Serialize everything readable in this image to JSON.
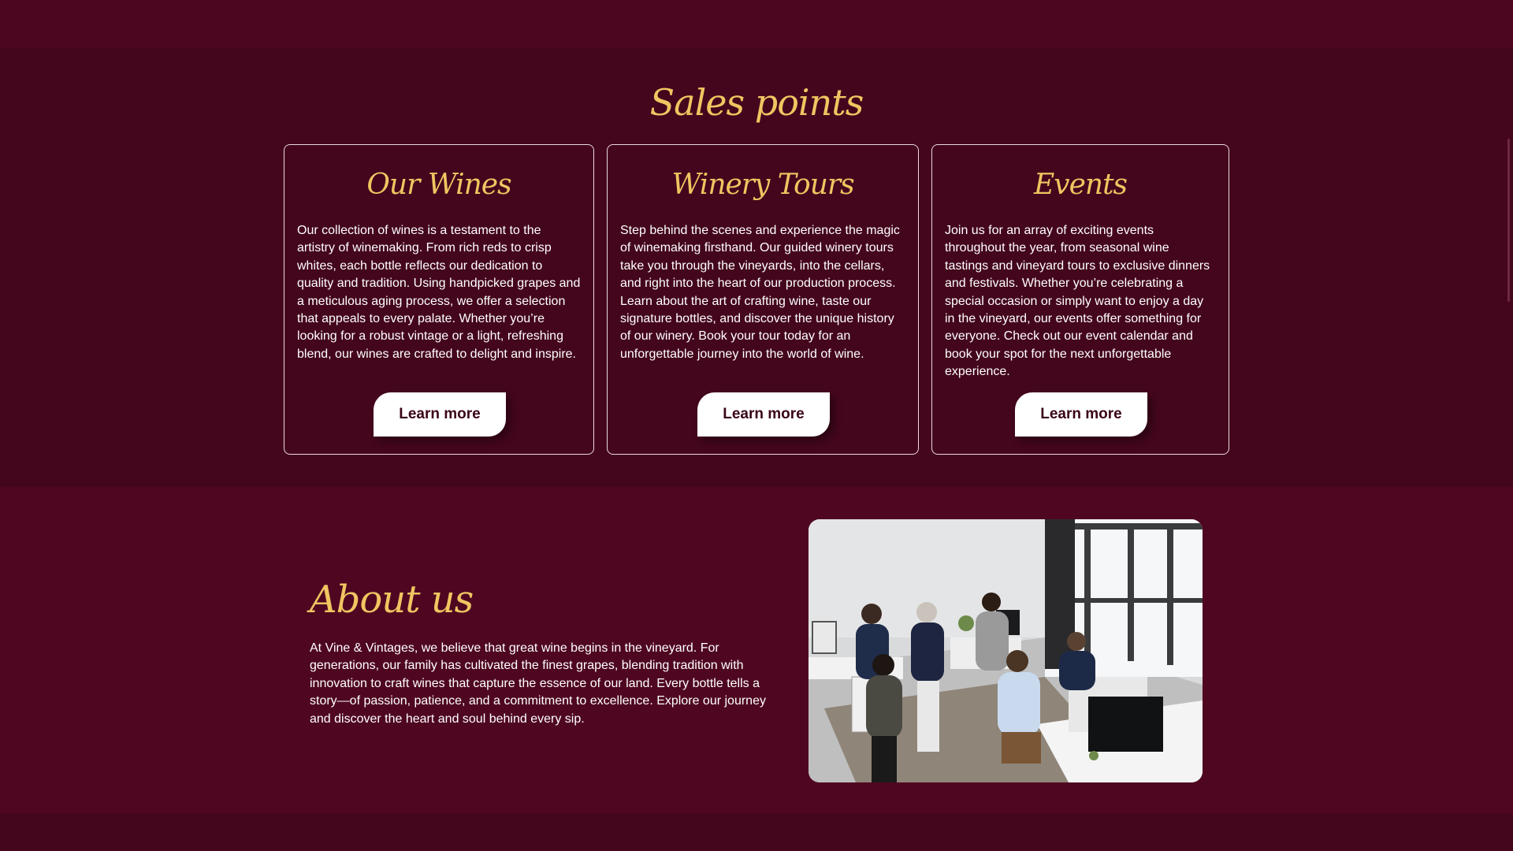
{
  "sales": {
    "title": "Sales points",
    "cards": [
      {
        "title": "Our Wines",
        "text": "Our collection of wines is a testament to the artistry of winemaking. From rich reds to crisp whites, each bottle reflects our dedication to quality and tradition. Using handpicked grapes and a meticulous aging process, we offer a selection that appeals to every palate. Whether you’re looking for a robust vintage or a light, refreshing blend, our wines are crafted to delight and inspire.",
        "button": "Learn more"
      },
      {
        "title": "Winery Tours",
        "text": "Step behind the scenes and experience the magic of winemaking firsthand. Our guided winery tours take you through the vineyards, into the cellars, and right into the heart of our production process. Learn about the art of crafting wine, taste our signature bottles, and discover the unique history of our winery. Book your tour today for an unforgettable journey into the world of wine.",
        "button": "Learn more"
      },
      {
        "title": "Events",
        "text": "Join us for an array of exciting events throughout the year, from seasonal wine tastings and vineyard tours to exclusive dinners and festivals. Whether you’re celebrating a special occasion or simply want to enjoy a day in the vineyard, our events offer something for everyone. Check out our event calendar and book your spot for the next unforgettable experience.",
        "button": "Learn more"
      }
    ]
  },
  "about": {
    "title": "About us",
    "text": "At Vine & Vintages, we believe that great wine begins in the vineyard. For generations, our family has cultivated the finest grapes, blending tradition with innovation to craft wines that capture the essence of our land. Every bottle tells a story—of passion, patience, and a commitment to excellence. Explore our journey and discover the heart and soul behind every sip."
  },
  "colors": {
    "background": "#4a0620",
    "accent": "#f1c561",
    "text": "#ffffff",
    "button_bg": "#ffffff",
    "button_text": "#3a0418"
  }
}
